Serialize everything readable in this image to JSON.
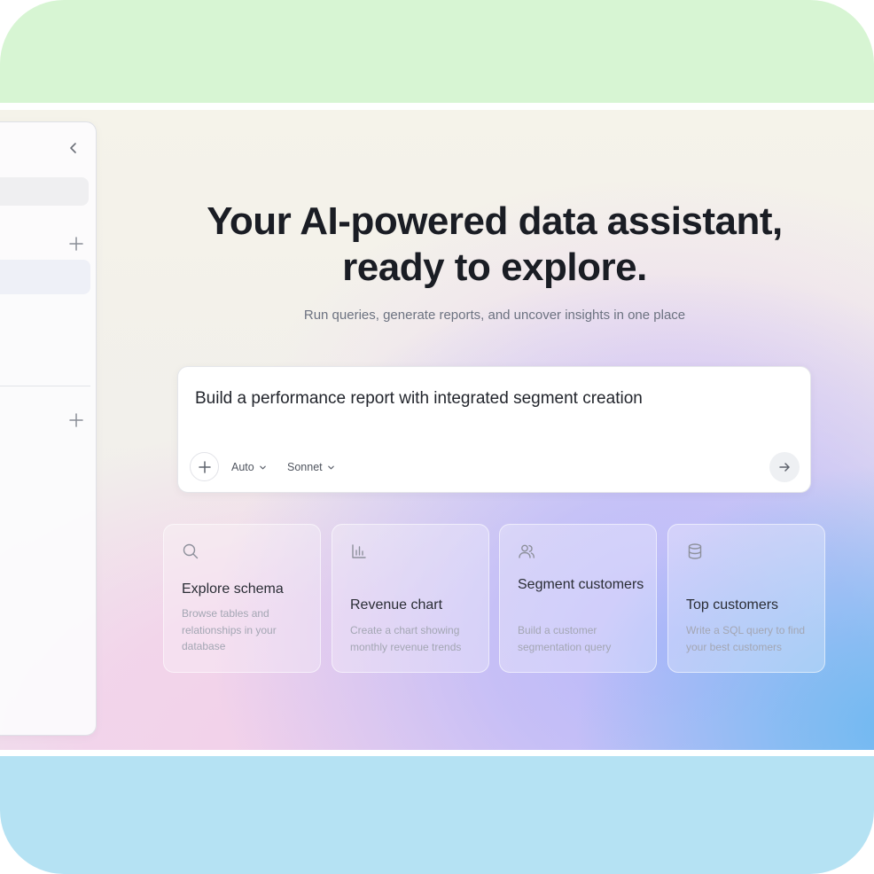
{
  "hero": {
    "title_line1": "Your AI-powered data assistant,",
    "title_line2": "ready to explore.",
    "subtitle": "Run queries, generate reports, and uncover insights in one place"
  },
  "prompt": {
    "text": "Build a performance report with integrated segment creation",
    "mode_label": "Auto",
    "model_label": "Sonnet"
  },
  "suggestions": [
    {
      "icon": "search-icon",
      "title": "Explore schema",
      "description": "Browse tables and relationships in your database"
    },
    {
      "icon": "bar-chart-icon",
      "title": "Revenue chart",
      "description": "Create a chart showing monthly revenue trends"
    },
    {
      "icon": "users-icon",
      "title": "Segment customers",
      "description": "Build a customer segmentation query"
    },
    {
      "icon": "database-icon",
      "title": "Top customers",
      "description": "Write a SQL query to find your best customers"
    }
  ],
  "sidebar": {
    "collapse_icon": "chevron-left-icon",
    "add_icon": "plus-icon"
  },
  "colors": {
    "top_band": "#d7f5d3",
    "bottom_band": "#b5e2f3",
    "headline": "#1a1d24",
    "accent_purple": "#b8b7fa",
    "accent_blue": "#6fb9f1"
  }
}
